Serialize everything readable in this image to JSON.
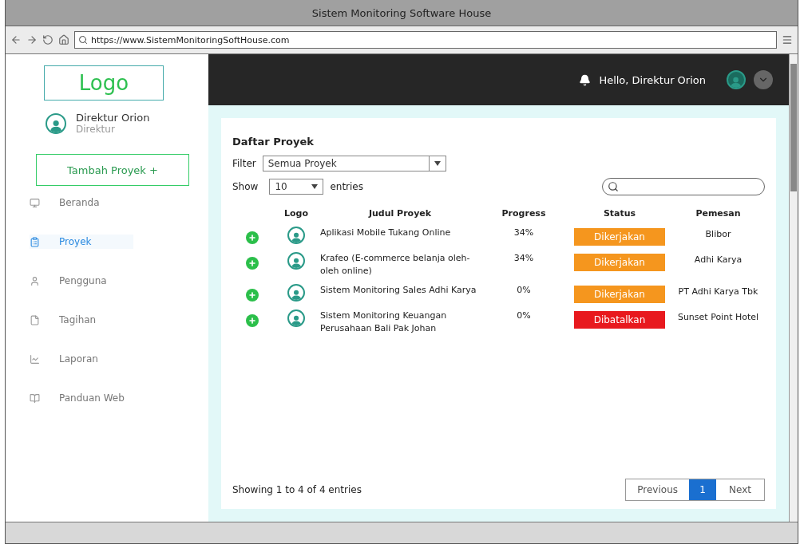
{
  "window": {
    "title": "Sistem Monitoring Software House"
  },
  "browser": {
    "url": "https://www.SistemMonitoringSoftHouse.com"
  },
  "sidebar": {
    "logo": "Logo",
    "user": {
      "name": "Direktur Orion",
      "role": "Direktur"
    },
    "add_button": "Tambah Proyek +",
    "items": [
      {
        "label": "Beranda",
        "selected": false
      },
      {
        "label": "Proyek",
        "selected": true
      },
      {
        "label": "Pengguna",
        "selected": false
      },
      {
        "label": "Tagihan",
        "selected": false
      },
      {
        "label": "Laporan",
        "selected": false
      },
      {
        "label": "Panduan Web",
        "selected": false
      }
    ]
  },
  "topbar": {
    "greeting": "Hello, Direktur Orion"
  },
  "panel": {
    "title": "Daftar Proyek",
    "filter_label": "Filter",
    "filter_value": "Semua Proyek",
    "show_label": "Show",
    "show_value": "10",
    "entries_label": "entries",
    "columns": [
      "",
      "Logo",
      "Judul Proyek",
      "Progress",
      "Status",
      "Pemesan"
    ],
    "rows": [
      {
        "title": "Aplikasi Mobile Tukang Online",
        "progress": "34%",
        "status": "Dikerjakan",
        "color": "#f5961e",
        "client": "Blibor"
      },
      {
        "title": "Krafeo (E-commerce belanja oleh-oleh online)",
        "progress": "34%",
        "status": "Dikerjakan",
        "color": "#f5961e",
        "client": "Adhi Karya"
      },
      {
        "title": "Sistem Monitoring Sales Adhi Karya",
        "progress": "0%",
        "status": "Dikerjakan",
        "color": "#f5961e",
        "client": "PT Adhi Karya Tbk"
      },
      {
        "title": "Sistem Monitoring Keuangan Perusahaan Bali Pak Johan",
        "progress": "0%",
        "status": "Dibatalkan",
        "color": "#e8191e",
        "client": "Sunset Point Hotel"
      }
    ],
    "info": "Showing 1 to 4 of 4 entries",
    "pagination": [
      {
        "label": "Previous",
        "selected": false
      },
      {
        "label": "1",
        "selected": true
      },
      {
        "label": "Next",
        "selected": false
      }
    ]
  }
}
